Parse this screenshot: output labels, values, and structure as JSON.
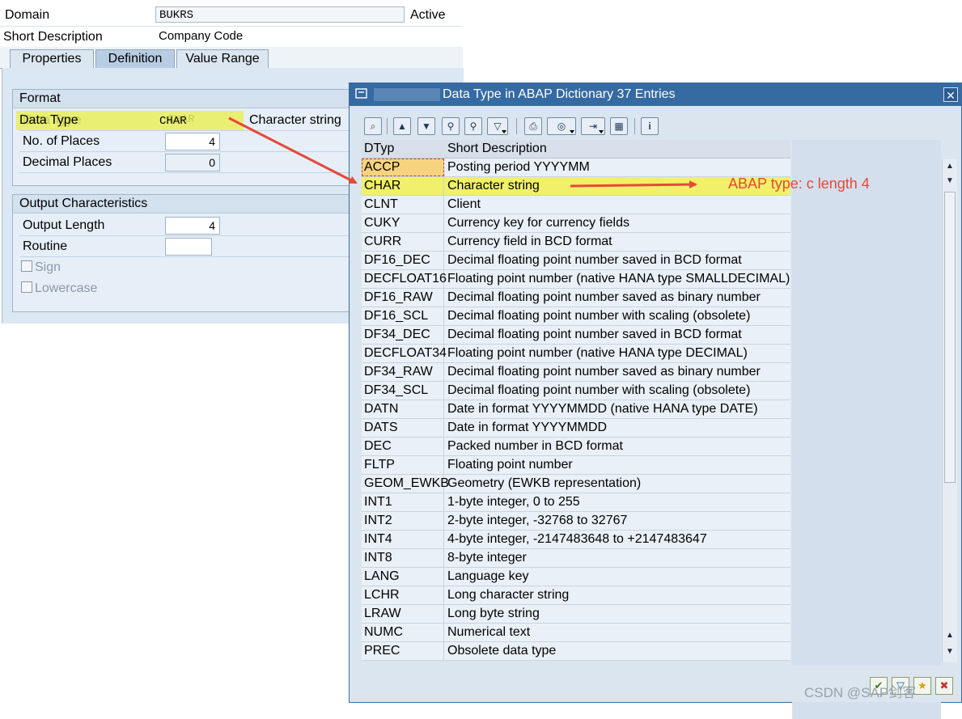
{
  "domain_screen": {
    "domain_label": "Domain",
    "domain_value": "BUKRS",
    "status": "Active",
    "short_desc_label": "Short Description",
    "short_desc_value": "Company Code",
    "tabs": [
      {
        "label": "Properties"
      },
      {
        "label": "Definition"
      },
      {
        "label": "Value Range"
      }
    ],
    "format": {
      "title": "Format",
      "data_type_label": "Data Type",
      "data_type_value": "CHAR",
      "data_type_desc": "Character string",
      "places_label": "No. of Places",
      "places_value": "4",
      "decimals_label": "Decimal Places",
      "decimals_value": "0"
    },
    "output": {
      "title": "Output Characteristics",
      "length_label": "Output Length",
      "length_value": "4",
      "routine_label": "Routine",
      "routine_value": "",
      "sign_label": "Sign",
      "lowercase_label": "Lowercase"
    }
  },
  "popup": {
    "title": "Data Type in ABAP Dictionary 37 Entries",
    "columns": {
      "dtyp": "DTyp",
      "desc": "Short Description"
    },
    "rows": [
      {
        "dtyp": "ACCP",
        "desc": "Posting period YYYYMM"
      },
      {
        "dtyp": "CHAR",
        "desc": "Character string"
      },
      {
        "dtyp": "CLNT",
        "desc": "Client"
      },
      {
        "dtyp": "CUKY",
        "desc": "Currency key for currency fields"
      },
      {
        "dtyp": "CURR",
        "desc": "Currency field in BCD format"
      },
      {
        "dtyp": "DF16_DEC",
        "desc": "Decimal floating point number saved in BCD format"
      },
      {
        "dtyp": "DECFLOAT16",
        "desc": "Floating point number (native HANA type SMALLDECIMAL)"
      },
      {
        "dtyp": "DF16_RAW",
        "desc": "Decimal floating point number saved as binary number"
      },
      {
        "dtyp": "DF16_SCL",
        "desc": "Decimal floating point number with scaling (obsolete)"
      },
      {
        "dtyp": "DF34_DEC",
        "desc": "Decimal floating point number saved in BCD format"
      },
      {
        "dtyp": "DECFLOAT34",
        "desc": "Floating point number (native HANA type DECIMAL)"
      },
      {
        "dtyp": "DF34_RAW",
        "desc": "Decimal floating point number saved as binary number"
      },
      {
        "dtyp": "DF34_SCL",
        "desc": "Decimal floating point number with scaling (obsolete)"
      },
      {
        "dtyp": "DATN",
        "desc": "Date in format YYYYMMDD (native HANA type DATE)"
      },
      {
        "dtyp": "DATS",
        "desc": "Date in format YYYYMMDD"
      },
      {
        "dtyp": "DEC",
        "desc": "Packed number in BCD format"
      },
      {
        "dtyp": "FLTP",
        "desc": "Floating point number"
      },
      {
        "dtyp": "GEOM_EWKB",
        "desc": "Geometry (EWKB representation)"
      },
      {
        "dtyp": "INT1",
        "desc": "1-byte integer, 0 to 255"
      },
      {
        "dtyp": "INT2",
        "desc": "2-byte integer, -32768 to 32767"
      },
      {
        "dtyp": "INT4",
        "desc": "4-byte integer, -2147483648 to +2147483647"
      },
      {
        "dtyp": "INT8",
        "desc": "8-byte integer"
      },
      {
        "dtyp": "LANG",
        "desc": "Language key"
      },
      {
        "dtyp": "LCHR",
        "desc": "Long character string"
      },
      {
        "dtyp": "LRAW",
        "desc": "Long byte string"
      },
      {
        "dtyp": "NUMC",
        "desc": "Numerical text"
      },
      {
        "dtyp": "PREC",
        "desc": "Obsolete data type"
      }
    ],
    "toolbar_icons": [
      "find-icon",
      "sort-ascending-icon",
      "sort-descending-icon",
      "find-next-icon",
      "find-more-icon",
      "filter-icon",
      "print-icon",
      "export-icon",
      "spreadsheet-icon",
      "layout-grid-icon",
      "info-icon"
    ],
    "bottom_icons": [
      "copy-check-icon",
      "filter-confirm-icon",
      "favorite-add-icon",
      "cancel-icon"
    ]
  },
  "annotation": {
    "text": "ABAP type:  c length 4"
  },
  "watermark": "CSDN @SAP剑客",
  "colors": {
    "titlebar": "#356aa3",
    "highlight": "#f1f06a",
    "arrow": "#e8473a",
    "panel": "#dbe7f3"
  }
}
